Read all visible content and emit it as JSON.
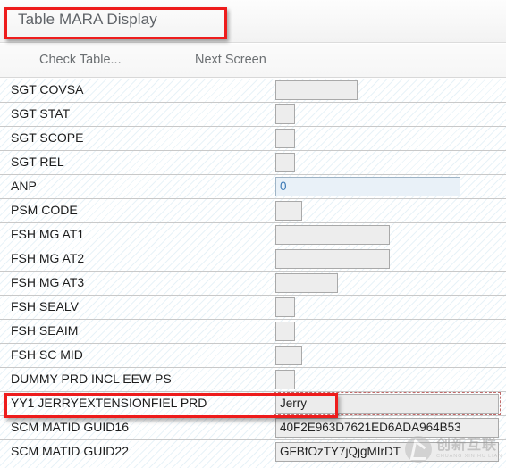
{
  "window": {
    "title": "Table MARA Display"
  },
  "toolbar": {
    "buttons": [
      {
        "label": "Check Table..."
      },
      {
        "label": "Next Screen"
      }
    ]
  },
  "form": {
    "rows": [
      {
        "label": "SGT COVSA",
        "value": "",
        "size": "w-l",
        "style": "plain"
      },
      {
        "label": "SGT STAT",
        "value": "",
        "size": "w-xs",
        "style": "plain"
      },
      {
        "label": "SGT SCOPE",
        "value": "",
        "size": "w-xs",
        "style": "plain"
      },
      {
        "label": "SGT REL",
        "value": "",
        "size": "w-xs",
        "style": "plain"
      },
      {
        "label": "ANP",
        "value": "0",
        "size": "w-xxl",
        "style": "blue"
      },
      {
        "label": "PSM CODE",
        "value": "",
        "size": "w-s",
        "style": "plain"
      },
      {
        "label": "FSH MG AT1",
        "value": "",
        "size": "w-xl",
        "style": "plain"
      },
      {
        "label": "FSH MG AT2",
        "value": "",
        "size": "w-xl",
        "style": "plain"
      },
      {
        "label": "FSH MG AT3",
        "value": "",
        "size": "w-m",
        "style": "plain"
      },
      {
        "label": "FSH SEALV",
        "value": "",
        "size": "w-xs",
        "style": "plain"
      },
      {
        "label": "FSH SEAIM",
        "value": "",
        "size": "w-xs",
        "style": "plain"
      },
      {
        "label": "FSH SC MID",
        "value": "",
        "size": "w-s",
        "style": "plain"
      },
      {
        "label": "DUMMY PRD INCL EEW PS",
        "value": "",
        "size": "w-xs",
        "style": "plain"
      },
      {
        "label": "YY1 JERRYEXTENSIONFIEL PRD",
        "value": "Jerry",
        "size": "w-ov",
        "style": "focused"
      },
      {
        "label": "SCM MATID GUID16",
        "value": "40F2E963D7621ED6ADA964B53",
        "size": "w-ov",
        "style": "plain"
      },
      {
        "label": "SCM MATID GUID22",
        "value": "GFBfOzTY7jQjgMIrDT",
        "size": "w-ov",
        "style": "plain"
      }
    ]
  },
  "annotations": {
    "color": "#ee1c1c",
    "title_box_target": "Table MARA Display",
    "field_box_target": "YY1 JERRYEXTENSIONFIEL PRD"
  },
  "watermark": {
    "cn_text": "创新互联",
    "en_text": "CHUANG XIN HU LIAN"
  }
}
